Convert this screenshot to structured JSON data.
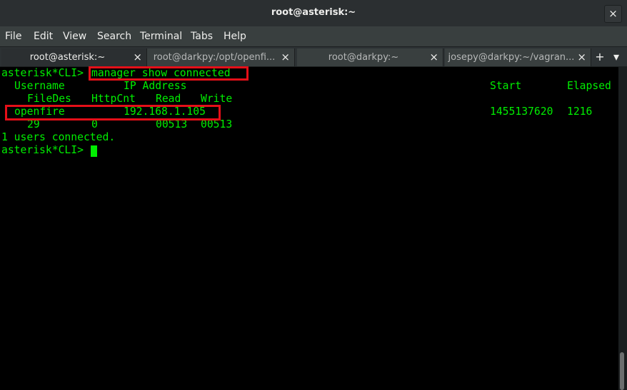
{
  "window": {
    "title": "root@asterisk:~",
    "close_glyph": "×"
  },
  "menu": [
    "File",
    "Edit",
    "View",
    "Search",
    "Terminal",
    "Tabs",
    "Help"
  ],
  "tabs": [
    {
      "label": "root@asterisk:~",
      "close_glyph": "×",
      "active": true
    },
    {
      "label": "root@darkpy:/opt/openfi...",
      "close_glyph": "×",
      "active": false
    },
    {
      "label": "root@darkpy:~",
      "close_glyph": "×",
      "active": false
    },
    {
      "label": "josepy@darkpy:~/vagran...",
      "close_glyph": "×",
      "active": false
    }
  ],
  "tab_controls": {
    "add_glyph": "+",
    "menu_glyph": "▾"
  },
  "terminal": {
    "prompt": "asterisk*CLI>",
    "command": "manager show connected",
    "header": {
      "username": "Username",
      "ip_address": "IP Address",
      "start": "Start",
      "elapsed": "Elapsed",
      "filedes": "FileDes",
      "httpcnt": "HttpCnt",
      "read": "Read",
      "write": "Write"
    },
    "row": {
      "username": "openfire",
      "ip_address": "192.168.1.105",
      "start": "1455137620",
      "elapsed": "1216",
      "filedes": "29",
      "httpcnt": "0",
      "read": "00513",
      "write": "00513"
    },
    "summary": "1 users connected.",
    "prompt2": "asterisk*CLI>"
  },
  "colors": {
    "terminal_fg": "#00ee00",
    "terminal_bg": "#000000",
    "highlight": "#e50f18"
  }
}
